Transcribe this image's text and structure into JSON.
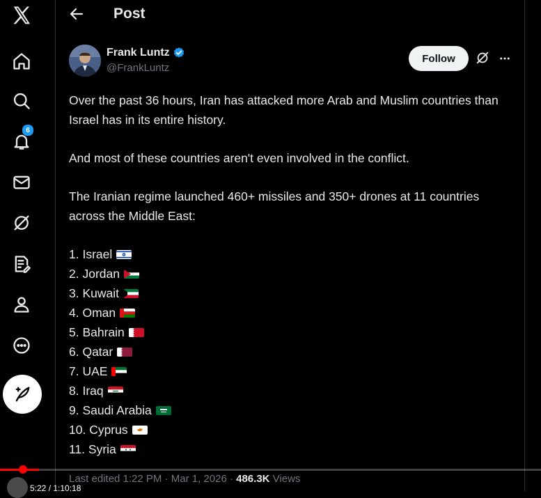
{
  "header": {
    "title": "Post"
  },
  "sidebar": {
    "items": [
      {
        "name": "home-icon"
      },
      {
        "name": "search-icon"
      },
      {
        "name": "notifications-icon",
        "badge": "6"
      },
      {
        "name": "messages-icon"
      },
      {
        "name": "grok-icon"
      },
      {
        "name": "lists-icon"
      },
      {
        "name": "profile-icon"
      },
      {
        "name": "more-icon"
      }
    ]
  },
  "post": {
    "author_name": "Frank Luntz",
    "author_handle": "@FrankLuntz",
    "follow_label": "Follow",
    "paragraphs": [
      "Over the past 36 hours, Iran has attacked more Arab and Muslim countries than Israel has in its entire history.",
      "And most of these countries aren't even involved in the conflict.",
      "The Iranian regime launched 460+ missiles and 350+ drones at 11 countries across the Middle East:"
    ],
    "countries": [
      {
        "label": "1. Israel",
        "flag": "israel-flag"
      },
      {
        "label": "2. Jordan",
        "flag": "jordan-flag"
      },
      {
        "label": "3. Kuwait",
        "flag": "kuwait-flag"
      },
      {
        "label": "4. Oman",
        "flag": "oman-flag"
      },
      {
        "label": "5. Bahrain",
        "flag": "bahrain-flag"
      },
      {
        "label": "6. Qatar",
        "flag": "qatar-flag"
      },
      {
        "label": "7. UAE",
        "flag": "uae-flag"
      },
      {
        "label": "8. Iraq",
        "flag": "iraq-flag"
      },
      {
        "label": "9. Saudi Arabia",
        "flag": "saudi-arabia-flag"
      },
      {
        "label": "10. Cyprus",
        "flag": "cyprus-flag"
      },
      {
        "label": "11. Syria",
        "flag": "syria-flag"
      }
    ],
    "footer": {
      "edited": "Last edited 1:22 PM · Mar 1, 2026 · ",
      "views_count": "486.3K",
      "views_label": " Views"
    }
  },
  "video": {
    "timecode": "5:22 / 1:10:18",
    "progress_fraction": 0.04
  },
  "colors": {
    "accent": "#1d9bf0",
    "background": "#000000",
    "muted": "#71767b",
    "youtube_red": "#ff0000"
  }
}
